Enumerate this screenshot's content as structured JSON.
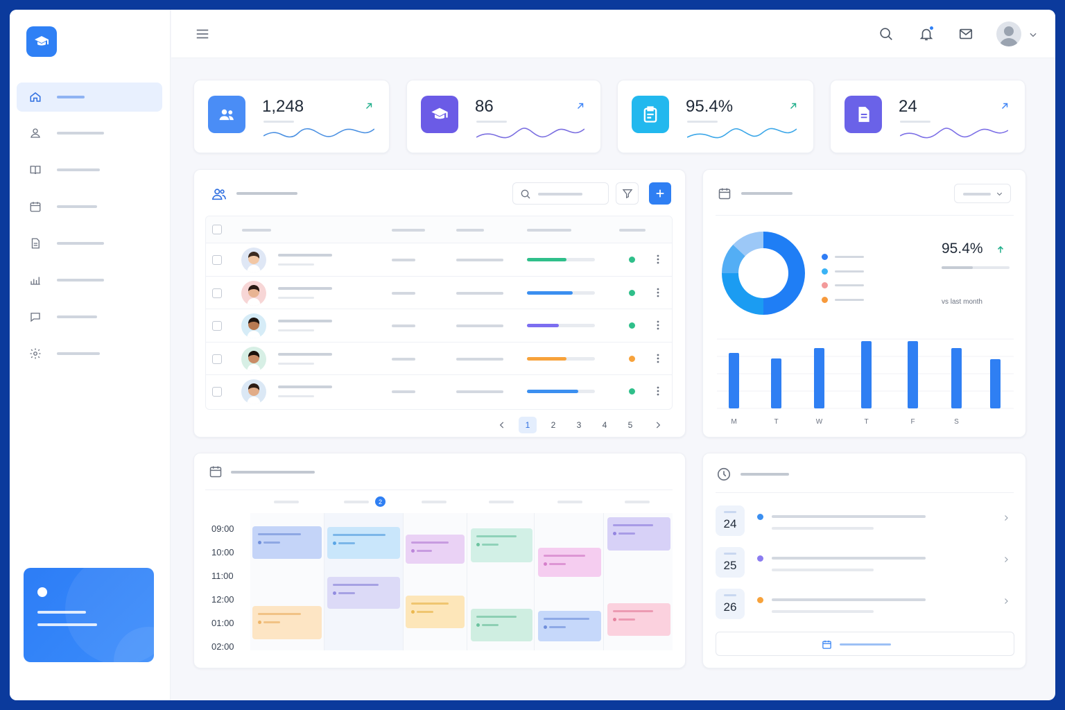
{
  "stats": [
    {
      "value": "1,248",
      "icon": "users-icon",
      "color": "#4a8df6",
      "line_color": "#4a90e2"
    },
    {
      "value": "86",
      "icon": "graduation-cap-icon",
      "color": "#6b5be6",
      "line_color": "#7a6ee0"
    },
    {
      "value": "95.4%",
      "icon": "clipboard-icon",
      "color": "#22b8ee",
      "line_color": "#3aa6e8"
    },
    {
      "value": "24",
      "icon": "document-icon",
      "color": "#6a62e8",
      "line_color": "#7b6ee6"
    }
  ],
  "table": {
    "rows": [
      {
        "progress": 0.58,
        "bar_color": "#2fbf8a",
        "status_color": "#2fbf8a"
      },
      {
        "progress": 0.67,
        "bar_color": "#3b8ff0",
        "status_color": "#2fbf8a"
      },
      {
        "progress": 0.47,
        "bar_color": "#7c6ef0",
        "status_color": "#2fbf8a"
      },
      {
        "progress": 0.58,
        "bar_color": "#f7a23b",
        "status_color": "#f7a23b"
      },
      {
        "progress": 0.75,
        "bar_color": "#3b8ff0",
        "status_color": "#2fbf8a"
      }
    ],
    "pagination": [
      "1",
      "2",
      "3",
      "4",
      "5"
    ]
  },
  "overview": {
    "percent": "95.4%",
    "caption": "vs last month",
    "donut": [
      {
        "share": 0.5,
        "color": "#1f7ef5"
      },
      {
        "share": 0.25,
        "color": "#1b9cf2"
      },
      {
        "share": 0.12,
        "color": "#53aef5"
      },
      {
        "share": 0.13,
        "color": "#9cc8f7"
      }
    ],
    "legend_colors": [
      "#2f7df5",
      "#3ab3f5",
      "#f39a9a",
      "#f79a3c"
    ],
    "bar_days": [
      "M",
      "T",
      "W",
      "T",
      "F",
      "S",
      ""
    ],
    "bar_values": [
      80,
      72,
      87,
      97,
      97,
      87,
      71
    ],
    "bar_color": "#2f7ff3"
  },
  "schedule": {
    "times": [
      "09:00",
      "10:00",
      "11:00",
      "12:00",
      "01:00",
      "02:00"
    ],
    "badge": "2"
  },
  "upcoming": {
    "dates": [
      "24",
      "25",
      "26"
    ],
    "dot_colors": [
      "#3b8ff0",
      "#8b7cf0",
      "#f7a23b"
    ]
  }
}
